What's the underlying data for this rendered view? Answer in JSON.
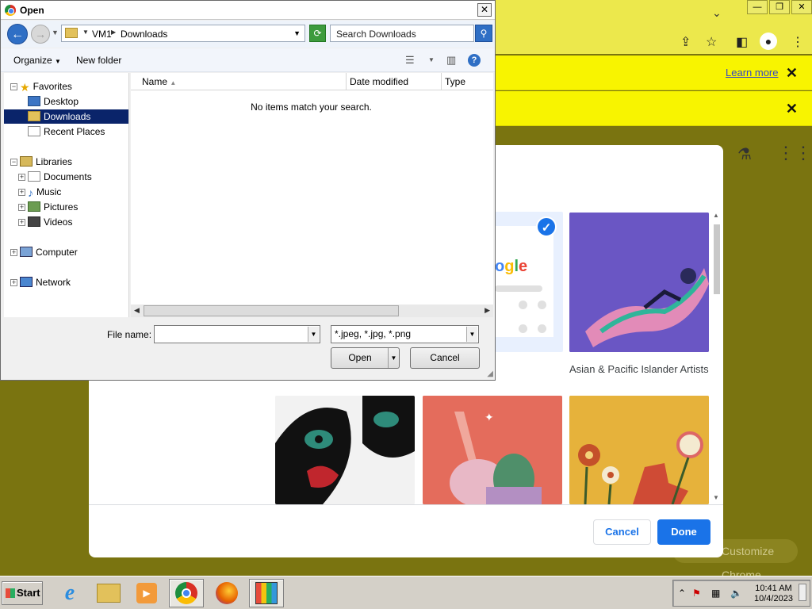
{
  "chrome": {
    "infobar1_link": "Learn more",
    "infobar_close": "✕",
    "customize_label": "Customize Chrome"
  },
  "customize_dialog": {
    "tile_label": "Asian & Pacific Islander Artists",
    "google_logo_text": "ogle",
    "cancel_label": "Cancel",
    "done_label": "Done"
  },
  "open_dialog": {
    "title": "Open",
    "close_label": "✕",
    "breadcrumb": [
      "VM1",
      "Downloads"
    ],
    "search_placeholder": "Search Downloads",
    "organize_label": "Organize",
    "new_folder_label": "New folder",
    "nav": {
      "favorites": "Favorites",
      "desktop": "Desktop",
      "downloads": "Downloads",
      "recent": "Recent Places",
      "libraries": "Libraries",
      "documents": "Documents",
      "music": "Music",
      "pictures": "Pictures",
      "videos": "Videos",
      "computer": "Computer",
      "network": "Network"
    },
    "columns": [
      "Name",
      "Date modified",
      "Type"
    ],
    "empty_message": "No items match your search.",
    "file_name_label": "File name:",
    "file_name_value": "",
    "file_type_value": "*.jpeg, *.jpg, *.png",
    "open_label": "Open",
    "cancel_label": "Cancel"
  },
  "taskbar": {
    "start_label": "Start",
    "clock_time": "10:41 AM",
    "clock_date": "10/4/2023"
  },
  "colors": {
    "chrome_yellow": "#ece84c",
    "infobar_yellow": "#f8f400",
    "backdrop_olive": "#7a7410",
    "accent_blue": "#1a73e8",
    "selection_navy": "#0a246a"
  }
}
